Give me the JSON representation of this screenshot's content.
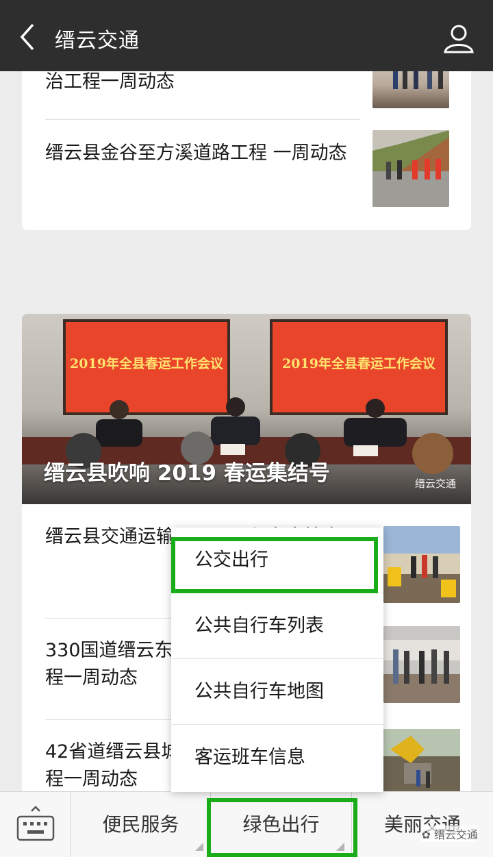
{
  "header": {
    "title": "缙云交通"
  },
  "articles_top": [
    {
      "title": "治工程一周动态"
    },
    {
      "title": "缙云县金谷至方溪道路工程 一周动态"
    }
  ],
  "hero": {
    "screen_text_left": "2019年全县春运工作会议",
    "screen_text_right": "2019年全县春运工作会议",
    "title": "缙云县吹响 2019 春运集结号",
    "watermark": "缙云交通"
  },
  "articles_bottom": [
    {
      "title": "缙云县交通运输局开展工程安全检查"
    },
    {
      "title": "330国道缙云东渡至壶镇段改建整治工程一周动态"
    },
    {
      "title": "42省道缙云县城至壶镇段改建整治工程一周动态"
    }
  ],
  "popup_menu": {
    "items": [
      "公交出行",
      "公共自行车列表",
      "公共自行车地图",
      "客运班车信息"
    ]
  },
  "bottom_menu": {
    "tabs": [
      "便民服务",
      "绿色出行",
      "美丽交通"
    ],
    "watermark": "缙云交通"
  },
  "colors": {
    "header_bg": "#2e2e2e",
    "highlight": "#1aad19",
    "screen": "#e9452a"
  }
}
